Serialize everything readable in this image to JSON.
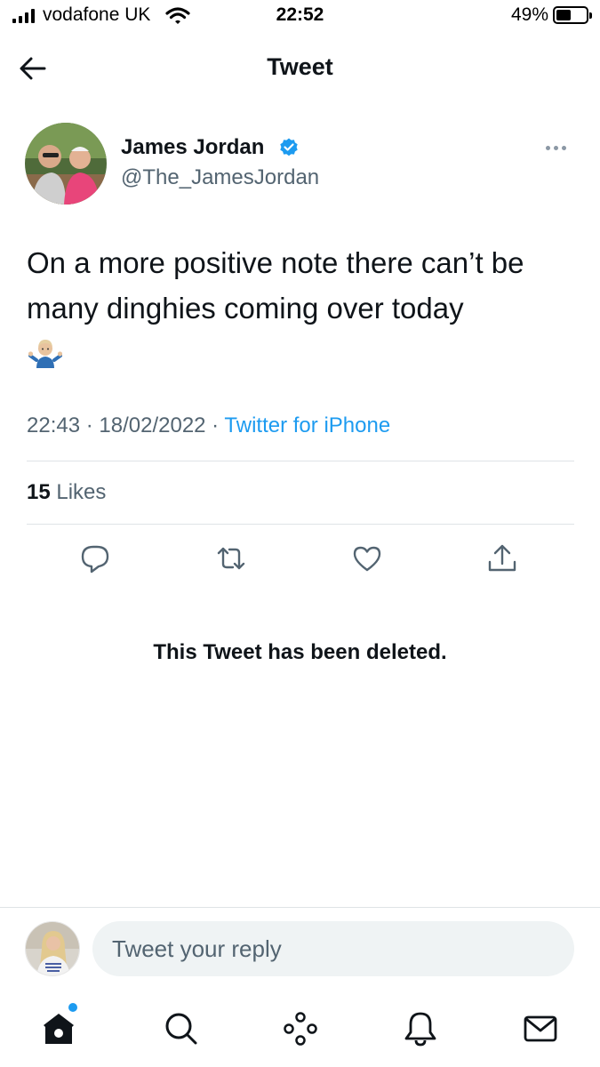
{
  "status_bar": {
    "carrier": "vodafone UK",
    "time": "22:52",
    "battery_percent": "49%",
    "battery_level": 0.49
  },
  "header": {
    "title": "Tweet"
  },
  "tweet": {
    "author_name": "James Jordan",
    "handle": "@The_JamesJordan",
    "verified": true,
    "text": "On a more positive note there can’t be many dinghies coming over today",
    "emoji": "person-shrugging",
    "time": "22:43",
    "date": "18/02/2022",
    "separator": " · ",
    "source": "Twitter for iPhone",
    "likes_count": "15",
    "likes_label": "Likes"
  },
  "quoted": {
    "deleted_message": "This Tweet has been deleted."
  },
  "reply": {
    "placeholder": "Tweet your reply"
  },
  "tab_bar": {
    "icons": [
      "home-icon",
      "search-icon",
      "spaces-icon",
      "notifications-icon",
      "messages-icon"
    ]
  },
  "colors": {
    "accent": "#1d9bf0",
    "text": "#0f1419",
    "secondary": "#536471",
    "divider": "#dfe3e6"
  }
}
